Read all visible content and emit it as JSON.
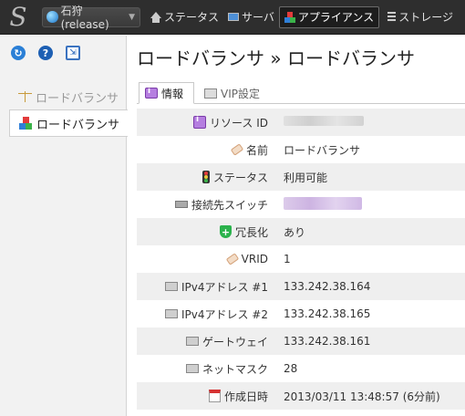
{
  "nav": {
    "zone": "石狩(release)",
    "items": [
      {
        "label": "ステータス"
      },
      {
        "label": "サーバ"
      },
      {
        "label": "アプライアンス"
      },
      {
        "label": "ストレージ"
      }
    ]
  },
  "sidebar": {
    "items": [
      {
        "label": "ロードバランサ"
      },
      {
        "label": "ロードバランサ"
      }
    ]
  },
  "page": {
    "title": "ロードバランサ » ロードバランサ",
    "tabs": [
      {
        "label": "情報"
      },
      {
        "label": "VIP設定"
      }
    ]
  },
  "details": [
    {
      "label": "リソース ID",
      "value": "",
      "icon": "info-icon"
    },
    {
      "label": "名前",
      "value": "ロードバランサ",
      "icon": "tag-icon"
    },
    {
      "label": "ステータス",
      "value": "利用可能",
      "icon": "traffic-light-icon"
    },
    {
      "label": "接続先スイッチ",
      "value": "",
      "icon": "switch-icon"
    },
    {
      "label": "冗長化",
      "value": "あり",
      "icon": "shield-icon"
    },
    {
      "label": "VRID",
      "value": "1",
      "icon": "tag-icon"
    },
    {
      "label": "IPv4アドレス #1",
      "value": "133.242.38.164",
      "icon": "nic-icon"
    },
    {
      "label": "IPv4アドレス #2",
      "value": "133.242.38.165",
      "icon": "nic-icon"
    },
    {
      "label": "ゲートウェイ",
      "value": "133.242.38.161",
      "icon": "nic-icon"
    },
    {
      "label": "ネットマスク",
      "value": "28",
      "icon": "nic-icon"
    },
    {
      "label": "作成日時",
      "value": "2013/03/11 13:48:57 (6分前)",
      "icon": "calendar-icon"
    }
  ]
}
